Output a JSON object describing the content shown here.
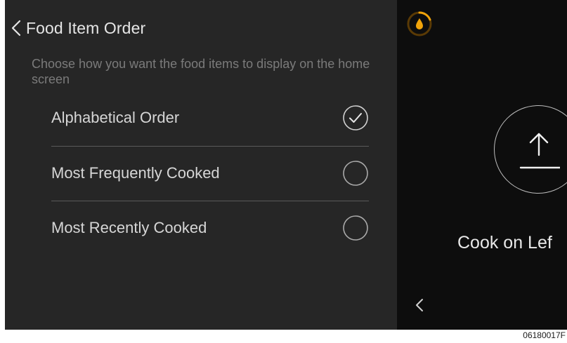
{
  "header": {
    "back_icon": "chevron-left-icon",
    "title": "Food Item Order"
  },
  "description": "Choose how you want the food items to display on the home screen",
  "options": [
    {
      "label": "Alphabetical Order",
      "selected": true
    },
    {
      "label": "Most Frequently Cooked",
      "selected": false
    },
    {
      "label": "Most Recently Cooked",
      "selected": false
    }
  ],
  "right_panel": {
    "status_icon": "droplet-timer-icon",
    "action_icon": "upload-arrow-icon",
    "cook_label": "Cook on Lef",
    "back_icon": "chevron-left-icon"
  },
  "figure_code": "06180017F",
  "colors": {
    "left_background": "#262626",
    "right_background": "#0d0d0d",
    "accent": "#f0a30a"
  }
}
